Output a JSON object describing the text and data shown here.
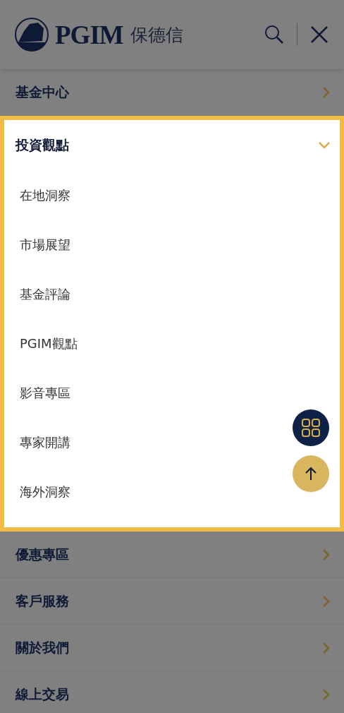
{
  "header": {
    "brand": "PGIM",
    "brand_cn": "保德信"
  },
  "menu": [
    {
      "label": "基金中心",
      "expanded": false
    },
    {
      "label": "投資觀點",
      "expanded": true,
      "children": [
        {
          "label": "在地洞察"
        },
        {
          "label": "市場展望"
        },
        {
          "label": "基金評論"
        },
        {
          "label": "PGIM觀點"
        },
        {
          "label": "影音專區"
        },
        {
          "label": "專家開講"
        },
        {
          "label": "海外洞察"
        }
      ]
    },
    {
      "label": "優惠專區",
      "expanded": false
    },
    {
      "label": "客戶服務",
      "expanded": false
    },
    {
      "label": "關於我們",
      "expanded": false
    },
    {
      "label": "線上交易",
      "expanded": false
    }
  ]
}
